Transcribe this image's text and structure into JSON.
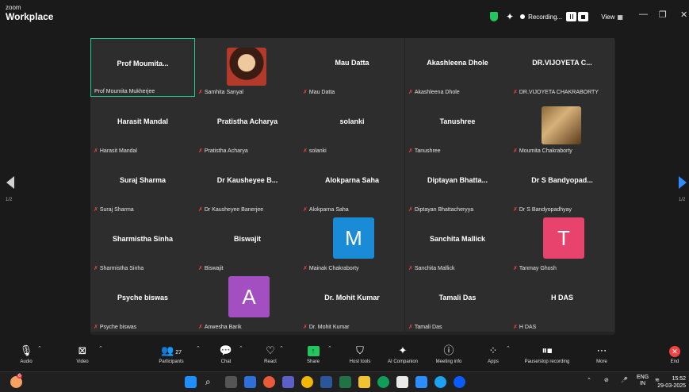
{
  "app": {
    "brand_top": "zoom",
    "brand_bottom": "Workplace"
  },
  "titlebar": {
    "recording_label": "Recording...",
    "view_label": "View"
  },
  "pager": {
    "left": "1/2",
    "right": "1/2"
  },
  "tiles": [
    {
      "display": "Prof  Moumita...",
      "label": "Prof Moumita Mukherjee",
      "muted": false,
      "active": true
    },
    {
      "display": "",
      "label": "Samhita Sanyal",
      "muted": true,
      "photo": true
    },
    {
      "display": "Mau Datta",
      "label": "Mau Datta",
      "muted": true
    },
    {
      "display": "Akashleena Dhole",
      "label": "Akashleena Dhole",
      "muted": true
    },
    {
      "display": "DR.VIJOYETA  C...",
      "label": "DR.VIJOYETA CHAKRABORTY",
      "muted": true
    },
    {
      "display": "Harasit Mandal",
      "label": "Harasit Mandal",
      "muted": true
    },
    {
      "display": "Pratistha Acharya",
      "label": "Pratistha Acharya",
      "muted": true
    },
    {
      "display": "solanki",
      "label": "solanki",
      "muted": true
    },
    {
      "display": "Tanushree",
      "label": "Tanushree",
      "muted": true
    },
    {
      "display": "",
      "label": "Moumita Chakraborty",
      "muted": true,
      "photo": true
    },
    {
      "display": "Suraj Sharma",
      "label": "Suraj Sharma",
      "muted": true
    },
    {
      "display": "Dr Kausheyee B...",
      "label": "Dr Kausheyee Banerjee",
      "muted": true
    },
    {
      "display": "Alokparna Saha",
      "label": "Alokparna Saha",
      "muted": true
    },
    {
      "display": "Diptayan  Bhatta...",
      "label": "Diptayan Bhattacheryya",
      "muted": true
    },
    {
      "display": "Dr S Bandyopad...",
      "label": "Dr S Bandyopadhyay",
      "muted": true
    },
    {
      "display": "Sharmistha Sinha",
      "label": "Sharmistha Sinha",
      "muted": true
    },
    {
      "display": "Biswajit",
      "label": "Biswajit",
      "muted": true
    },
    {
      "display": "",
      "label": "Mainak Chakraborty",
      "muted": true,
      "avatar": "M",
      "avatar_color": "#1a8bd6"
    },
    {
      "display": "Sanchita Mallick",
      "label": "Sanchita Mallick",
      "muted": true
    },
    {
      "display": "",
      "label": "Tanmay Ghosh",
      "muted": true,
      "avatar": "T",
      "avatar_color": "#e8436c"
    },
    {
      "display": "Psyche biswas",
      "label": "Psyche biswas",
      "muted": true
    },
    {
      "display": "",
      "label": "Anwesha Barik",
      "muted": true,
      "avatar": "A",
      "avatar_color": "#a44fc1"
    },
    {
      "display": "Dr. Mohit Kumar",
      "label": "Dr. Mohit Kumar",
      "muted": true
    },
    {
      "display": "Tamali Das",
      "label": "Tamali Das",
      "muted": true
    },
    {
      "display": "H DAS",
      "label": "H DAS",
      "muted": true
    }
  ],
  "toolbar": {
    "audio": "Audio",
    "video": "Video",
    "participants": "Participants",
    "participants_count": "27",
    "chat": "Chat",
    "react": "React",
    "share": "Share",
    "host_tools": "Host tools",
    "ai_companion": "AI Companion",
    "meeting_info": "Meeting info",
    "apps": "Apps",
    "pause_recording": "Pause/stop recording",
    "more": "More",
    "end": "End"
  },
  "taskbar": {
    "lang_top": "ENG",
    "lang_bottom": "IN",
    "time": "15:52",
    "date": "29-03-2025",
    "badge": "6"
  },
  "colors": {
    "active_border": "#20c997",
    "muted_icon": "#ef4444",
    "share_green": "#22c55e",
    "end_red": "#ef4444"
  }
}
